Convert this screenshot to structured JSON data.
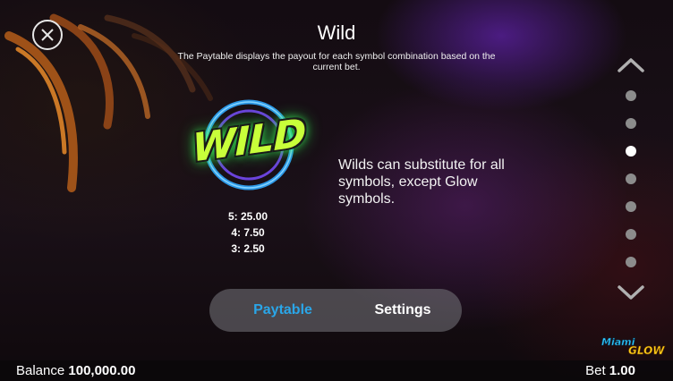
{
  "header": {
    "title": "Wild",
    "subtitle": "The Paytable displays the payout for each symbol combination based on the current bet."
  },
  "symbol": {
    "logo_text": "WILD",
    "payouts": [
      "5: 25.00",
      "4: 7.50",
      "3: 2.50"
    ],
    "description": "Wilds can substitute for all symbols, except Glow symbols."
  },
  "pager": {
    "count": 7,
    "active_index": 2
  },
  "tabs": [
    {
      "label": "Paytable",
      "active": true
    },
    {
      "label": "Settings",
      "active": false
    }
  ],
  "brand": {
    "logo_text": "Miami GLOW"
  },
  "status": {
    "balance_label": "Balance",
    "balance_value": "100,000.00",
    "bet_label": "Bet",
    "bet_value": "1.00"
  },
  "colors": {
    "active_tab": "#2aa6e8",
    "wild_green": "#c8ff3a",
    "ring_blue": "#2fa8ff"
  },
  "icons": [
    "close-icon",
    "chevron-up-icon",
    "chevron-down-icon"
  ]
}
